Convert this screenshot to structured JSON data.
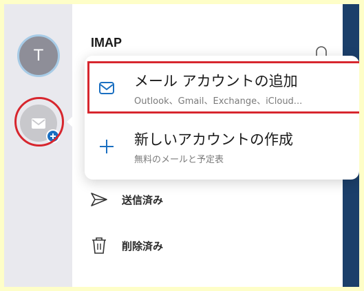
{
  "accounts_rail": {
    "avatar_initial": "T"
  },
  "folder_pane": {
    "title": "IMAP",
    "folders": [
      {
        "label": "送信済み",
        "icon": "send-icon"
      },
      {
        "label": "削除済み",
        "icon": "trash-icon"
      }
    ]
  },
  "add_account_menu": {
    "items": [
      {
        "title": "メール アカウントの追加",
        "subtitle": "Outlook、Gmail、Exchange、iCloud...",
        "icon": "mail-icon"
      },
      {
        "title": "新しいアカウントの作成",
        "subtitle": "無料のメールと予定表",
        "icon": "plus-icon"
      }
    ]
  },
  "colors": {
    "accent": "#1a6fc1",
    "highlight": "#d7262e",
    "page_background": "#fefec8",
    "rail_background": "#e9e9ee",
    "right_strip": "#1b3f6a"
  }
}
